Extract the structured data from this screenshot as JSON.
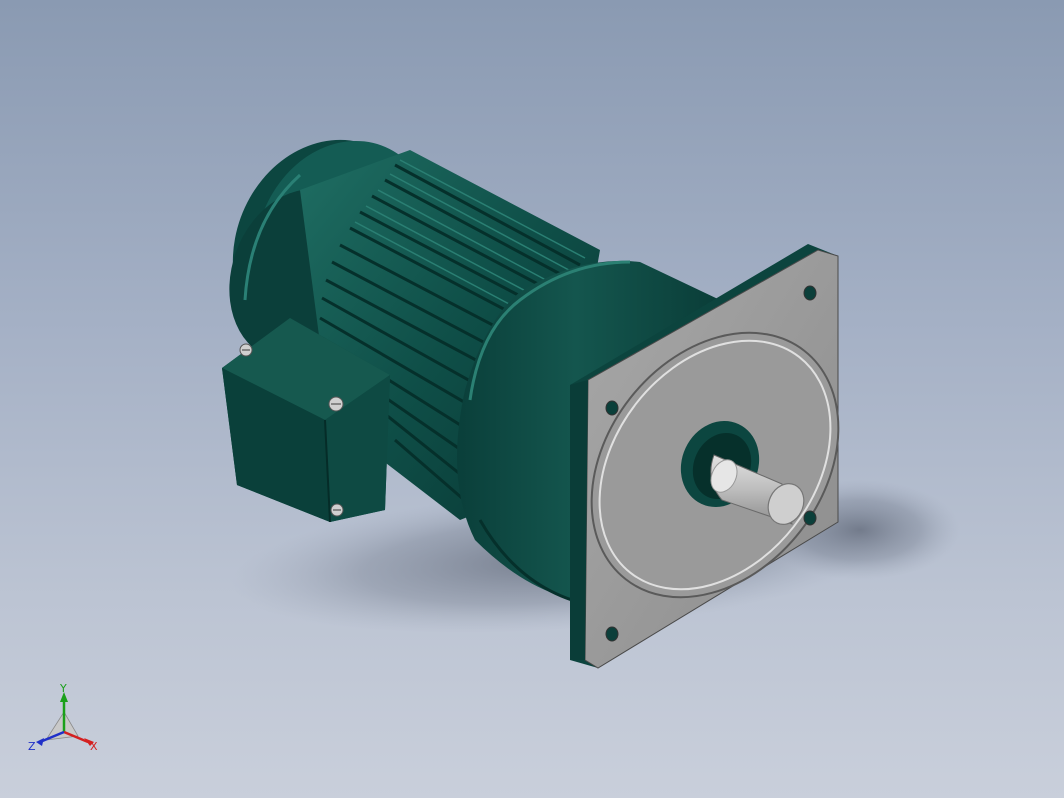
{
  "viewport": {
    "background_top": "#8a9ab2",
    "background_bottom": "#c9cfdb"
  },
  "model": {
    "name": "gear-motor",
    "body_color": "#0d4a44",
    "body_highlight": "#1e6b61",
    "body_shadow": "#06302c",
    "flange_color": "#9a9a9a",
    "flange_dark": "#6f6f6f",
    "shaft_color": "#c8c8c8"
  },
  "triad": {
    "x_label": "X",
    "y_label": "Y",
    "z_label": "Z",
    "x_color": "#d42020",
    "y_color": "#1aa01a",
    "z_color": "#2030c8"
  }
}
